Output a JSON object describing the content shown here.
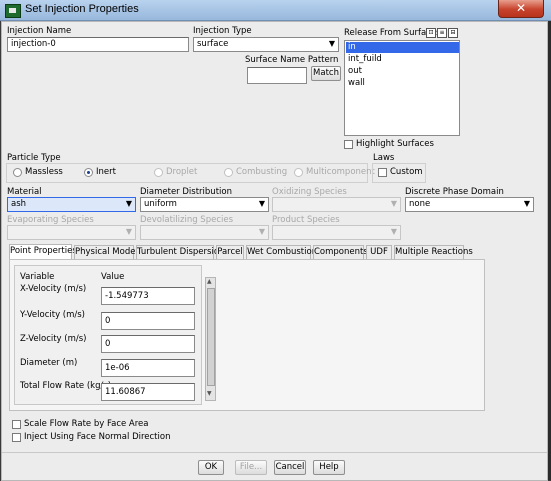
{
  "window": {
    "title": "Set Injection Properties",
    "close_label": "✕"
  },
  "injection_name": {
    "label": "Injection Name",
    "value": "injection-0"
  },
  "injection_type": {
    "label": "Injection Type",
    "value": "surface"
  },
  "surface_name_pattern": {
    "label": "Surface Name Pattern",
    "value": "",
    "match_label": "Match"
  },
  "release_from_surfaces": {
    "label": "Release From Surfaces",
    "items": [
      {
        "label": "in",
        "selected": true
      },
      {
        "label": "int_fuild",
        "selected": false
      },
      {
        "label": "out",
        "selected": false
      },
      {
        "label": "wall",
        "selected": false
      }
    ],
    "highlight_label": "Highlight Surfaces"
  },
  "particle_type": {
    "label": "Particle Type",
    "options": [
      "Massless",
      "Inert",
      "Droplet",
      "Combusting",
      "Multicomponent"
    ],
    "selected": "Inert"
  },
  "laws": {
    "label": "Laws",
    "custom_label": "Custom"
  },
  "material": {
    "label": "Material",
    "value": "ash"
  },
  "diameter_distribution": {
    "label": "Diameter Distribution",
    "value": "uniform"
  },
  "oxidizing_species": {
    "label": "Oxidizing Species",
    "value": ""
  },
  "discrete_phase_domain": {
    "label": "Discrete Phase Domain",
    "value": "none"
  },
  "evaporating_species": {
    "label": "Evaporating Species",
    "value": ""
  },
  "devolatilizing_species": {
    "label": "Devolatilizing Species",
    "value": ""
  },
  "product_species": {
    "label": "Product Species",
    "value": ""
  },
  "tabs": [
    "Point Properties",
    "Physical Models",
    "Turbulent Dispersion",
    "Parcel",
    "Wet Combustion",
    "Components",
    "UDF",
    "Multiple Reactions"
  ],
  "point_properties": {
    "header_variable": "Variable",
    "header_value": "Value",
    "rows": [
      {
        "label": "X-Velocity (m/s)",
        "value": "-1.549773"
      },
      {
        "label": "Y-Velocity (m/s)",
        "value": "0"
      },
      {
        "label": "Z-Velocity (m/s)",
        "value": "0"
      },
      {
        "label": "Diameter (m)",
        "value": "1e-06"
      },
      {
        "label": "Total Flow Rate (kg/s)",
        "value": "11.60867"
      }
    ]
  },
  "options": {
    "scale_flow_rate": "Scale Flow Rate by Face Area",
    "inject_face_normal": "Inject Using Face Normal Direction"
  },
  "buttons": {
    "ok": "OK",
    "file": "File...",
    "cancel": "Cancel",
    "help": "Help"
  },
  "colors": {
    "selection": "#3369e8",
    "close": "#c7432c",
    "titlebar": "#a9c6e6"
  }
}
